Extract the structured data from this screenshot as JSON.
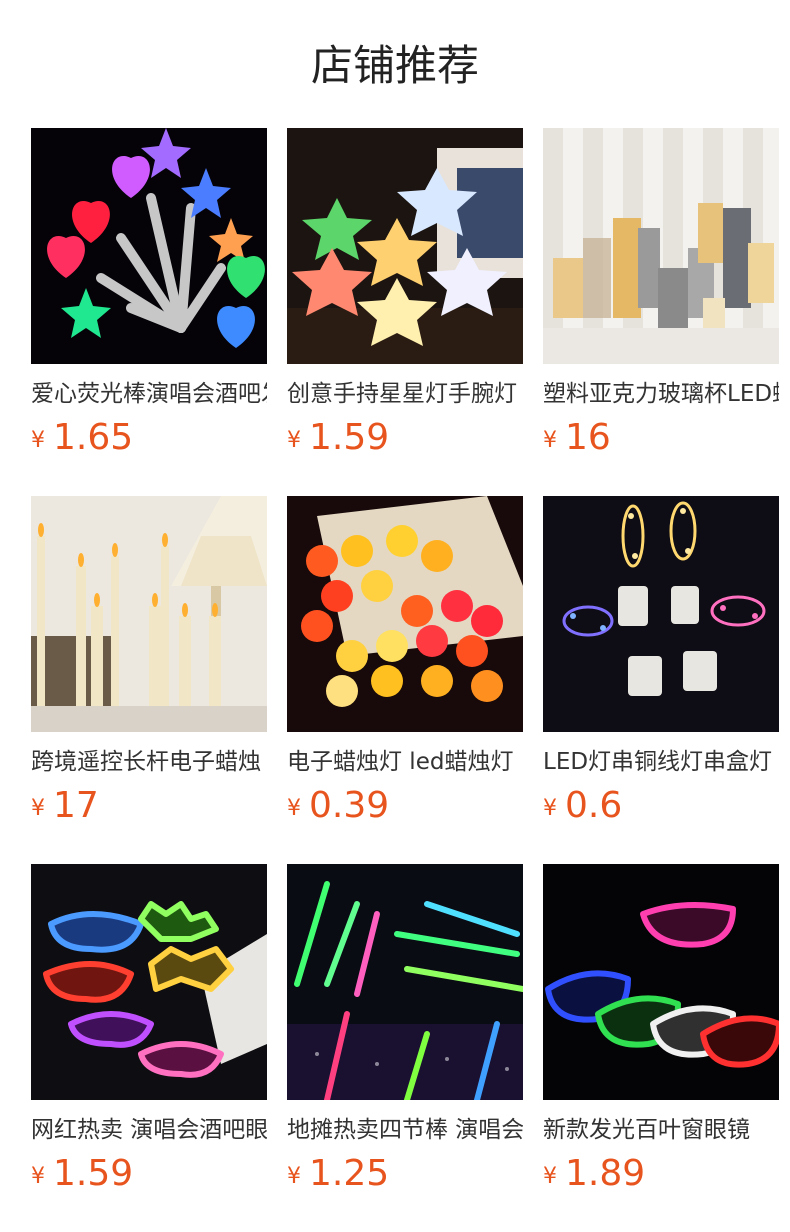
{
  "page": {
    "title": "店铺推荐"
  },
  "accent_color": "#e8541e",
  "products": [
    {
      "name": "爱心荧光棒演唱会酒吧发光道具",
      "currency": "¥",
      "price": "1.65",
      "image_icon": "heart-star-glow-sticks-image"
    },
    {
      "name": "创意手持星星灯手腕灯",
      "currency": "¥",
      "price": "1.59",
      "image_icon": "star-lamps-image"
    },
    {
      "name": "塑料亚克力玻璃杯LED蜡烛",
      "currency": "¥",
      "price": "16",
      "image_icon": "led-pillar-candles-image"
    },
    {
      "name": "跨境遥控长杆电子蜡烛",
      "currency": "¥",
      "price": "17",
      "image_icon": "taper-candles-image"
    },
    {
      "name": "电子蜡烛灯 led蜡烛灯",
      "currency": "¥",
      "price": "0.39",
      "image_icon": "heart-tea-lights-image"
    },
    {
      "name": "LED灯串铜线灯串盒灯",
      "currency": "¥",
      "price": "0.6",
      "image_icon": "copper-wire-string-lights-image"
    },
    {
      "name": "网红热卖 演唱会酒吧眼镜",
      "currency": "¥",
      "price": "1.59",
      "image_icon": "party-glasses-image"
    },
    {
      "name": "地摊热卖四节棒 演唱会",
      "currency": "¥",
      "price": "1.25",
      "image_icon": "four-section-glow-sticks-image"
    },
    {
      "name": "新款发光百叶窗眼镜",
      "currency": "¥",
      "price": "1.89",
      "image_icon": "shutter-glasses-image"
    }
  ]
}
